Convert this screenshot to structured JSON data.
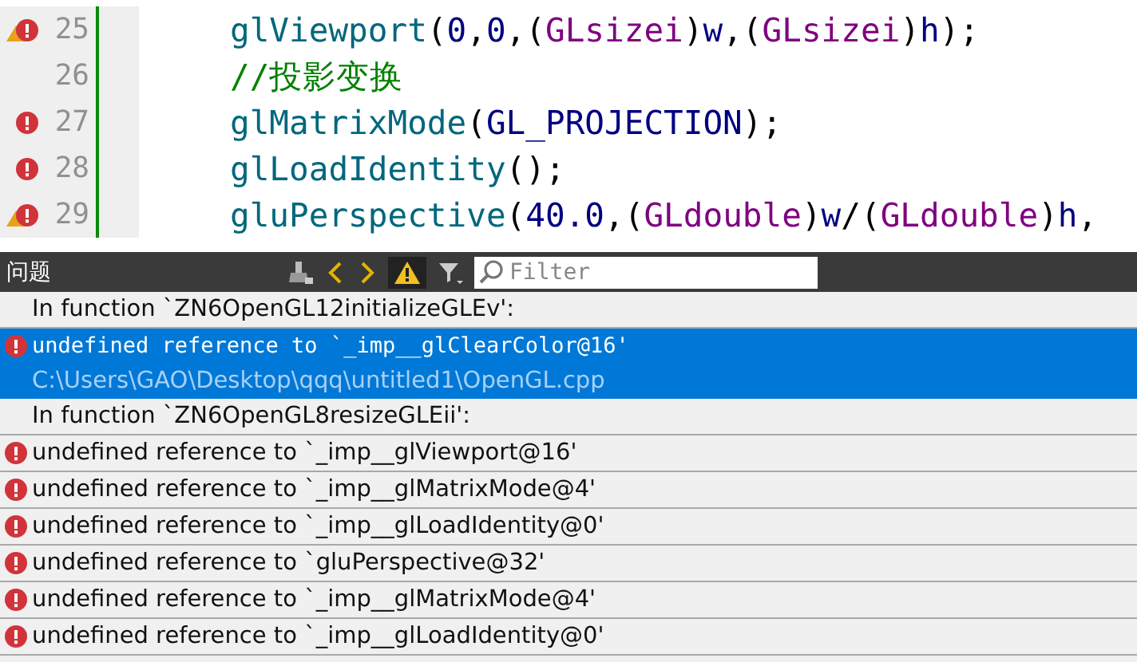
{
  "editor": {
    "lines": [
      {
        "number": "25",
        "warning": true,
        "error": true,
        "tokens": [
          {
            "kind": "func",
            "text": "glViewport"
          },
          {
            "kind": "punct",
            "text": "("
          },
          {
            "kind": "num",
            "text": "0"
          },
          {
            "kind": "punct",
            "text": ","
          },
          {
            "kind": "num",
            "text": "0"
          },
          {
            "kind": "punct",
            "text": ",("
          },
          {
            "kind": "type",
            "text": "GLsizei"
          },
          {
            "kind": "punct",
            "text": ")"
          },
          {
            "kind": "ident",
            "text": "w"
          },
          {
            "kind": "punct",
            "text": ",("
          },
          {
            "kind": "type",
            "text": "GLsizei"
          },
          {
            "kind": "punct",
            "text": ")"
          },
          {
            "kind": "ident",
            "text": "h"
          },
          {
            "kind": "punct",
            "text": ");"
          }
        ]
      },
      {
        "number": "26",
        "warning": false,
        "error": false,
        "tokens": [
          {
            "kind": "comment",
            "text": "//投影变换"
          }
        ]
      },
      {
        "number": "27",
        "warning": false,
        "error": true,
        "tokens": [
          {
            "kind": "func",
            "text": "glMatrixMode"
          },
          {
            "kind": "punct",
            "text": "("
          },
          {
            "kind": "ident",
            "text": "GL_PROJECTION"
          },
          {
            "kind": "punct",
            "text": ");"
          }
        ]
      },
      {
        "number": "28",
        "warning": false,
        "error": true,
        "tokens": [
          {
            "kind": "func",
            "text": "glLoadIdentity"
          },
          {
            "kind": "punct",
            "text": "();"
          }
        ]
      },
      {
        "number": "29",
        "warning": true,
        "error": true,
        "tokens": [
          {
            "kind": "func",
            "text": "gluPerspective"
          },
          {
            "kind": "punct",
            "text": "("
          },
          {
            "kind": "num",
            "text": "40.0"
          },
          {
            "kind": "punct",
            "text": ",("
          },
          {
            "kind": "type",
            "text": "GLdouble"
          },
          {
            "kind": "punct",
            "text": ")"
          },
          {
            "kind": "ident",
            "text": "w"
          },
          {
            "kind": "punct",
            "text": "/("
          },
          {
            "kind": "type",
            "text": "GLdouble"
          },
          {
            "kind": "punct",
            "text": ")"
          },
          {
            "kind": "ident",
            "text": "h"
          },
          {
            "kind": "punct",
            "text": ","
          }
        ]
      }
    ]
  },
  "issues_panel": {
    "title": "问题",
    "filter": {
      "placeholder": "Filter"
    },
    "warnings_filter_on": true,
    "rows": [
      {
        "kind": "group",
        "text": "In function `ZN6OpenGL12initializeGLEv':",
        "selected": false
      },
      {
        "kind": "error",
        "text": "undefined reference to `_imp__glClearColor@16'",
        "path": "C:\\Users\\GAO\\Desktop\\qqq\\untitled1\\OpenGL.cpp",
        "selected": true
      },
      {
        "kind": "group",
        "text": "In function `ZN6OpenGL8resizeGLEii':",
        "selected": false
      },
      {
        "kind": "error",
        "text": "undefined reference to `_imp__glViewport@16'",
        "selected": false
      },
      {
        "kind": "error",
        "text": "undefined reference to `_imp__glMatrixMode@4'",
        "selected": false
      },
      {
        "kind": "error",
        "text": "undefined reference to `_imp__glLoadIdentity@0'",
        "selected": false
      },
      {
        "kind": "error",
        "text": "undefined reference to `gluPerspective@32'",
        "selected": false
      },
      {
        "kind": "error",
        "text": "undefined reference to `_imp__glMatrixMode@4'",
        "selected": false
      },
      {
        "kind": "error",
        "text": "undefined reference to `_imp__glLoadIdentity@0'",
        "selected": false
      }
    ]
  }
}
